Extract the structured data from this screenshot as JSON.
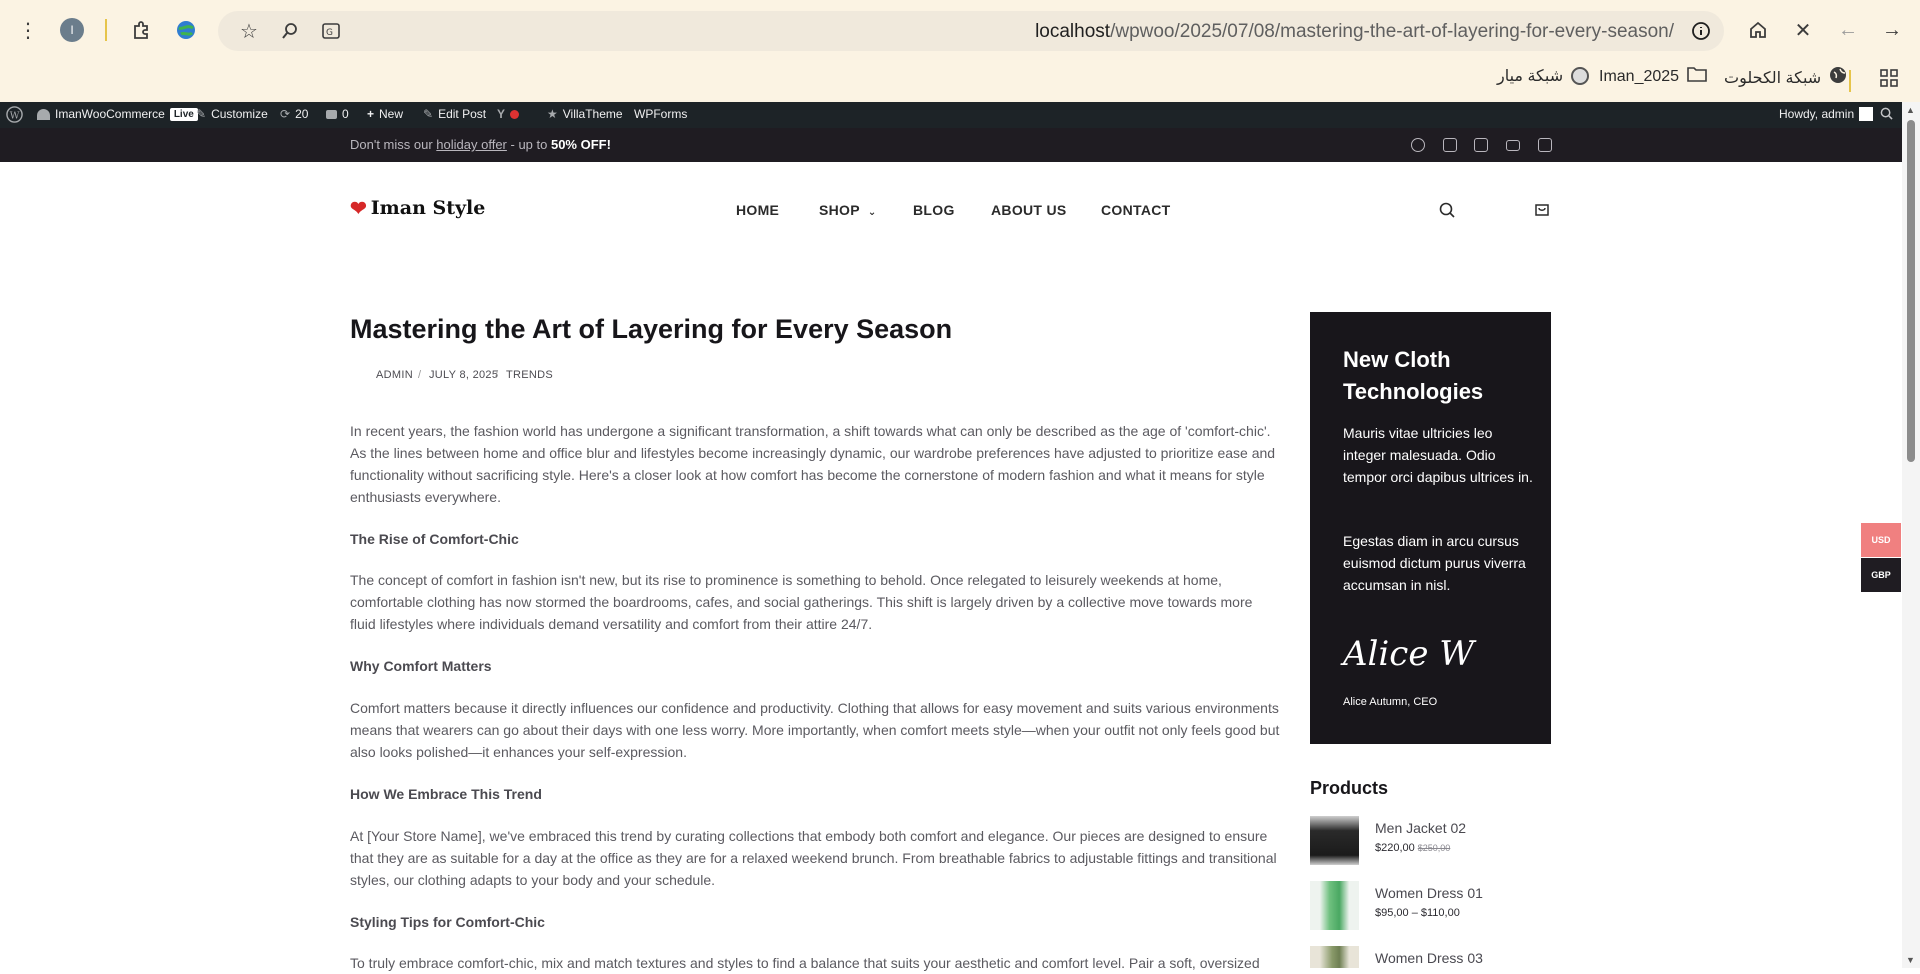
{
  "browser": {
    "url_host": "localhost",
    "url_path": "/wpwoo/2025/07/08/mastering-the-art-of-layering-for-every-season/",
    "profile_initial": "I",
    "bookmarks": [
      {
        "label": "شبكة الكحلوت",
        "icon": "globe-icon"
      },
      {
        "label": "Iman_2025",
        "icon": "folder-icon"
      },
      {
        "label": "شبكة ميار",
        "icon": "moon-icon"
      }
    ]
  },
  "admin_bar": {
    "site": "ImanWooCommerce",
    "live": "Live",
    "customize": "Customize",
    "updates": "20",
    "comments": "0",
    "new": "New",
    "edit_post": "Edit Post",
    "villatheme": "VillaTheme",
    "wpforms": "WPForms",
    "howdy": "Howdy, admin"
  },
  "promo": {
    "before": "Don't miss our ",
    "link": "holiday offer",
    "middle": " - up to ",
    "bold": "50% OFF!"
  },
  "header": {
    "logo": "Iman Style",
    "nav": [
      "HOME",
      "SHOP",
      "BLOG",
      "ABOUT US",
      "CONTACT"
    ]
  },
  "article": {
    "title": "Mastering the Art of Layering for Every Season",
    "author": "ADMIN",
    "date": "JULY 8, 2025",
    "category": "TRENDS",
    "p1": "In recent years, the fashion world has undergone a significant transformation, a shift towards what can only be described as the age of 'comfort-chic'. As the lines between home and office blur and lifestyles become increasingly dynamic, our wardrobe preferences have adjusted to prioritize ease and functionality without sacrificing style. Here's a closer look at how comfort has become the cornerstone of modern fashion and what it means for style enthusiasts everywhere.",
    "h1": "The Rise of Comfort-Chic",
    "p2": "The concept of comfort in fashion isn't new, but its rise to prominence is something to behold. Once relegated to leisurely weekends at home, comfortable clothing has now stormed the boardrooms, cafes, and social gatherings. This shift is largely driven by a collective move towards more fluid lifestyles where individuals demand versatility and comfort from their attire 24/7.",
    "h2": "Why Comfort Matters",
    "p3": "Comfort matters because it directly influences our confidence and productivity. Clothing that allows for easy movement and suits various environments means that wearers can go about their days with one less worry. More importantly, when comfort meets style—when your outfit not only feels good but also looks polished—it enhances your self-expression.",
    "h3": "How We Embrace This Trend",
    "p4": "At [Your Store Name], we've embraced this trend by curating collections that embody both comfort and elegance. Our pieces are designed to ensure that they are as suitable for a day at the office as they are for a relaxed weekend brunch. From breathable fabrics to adjustable fittings and transitional styles, our clothing adapts to your body and your schedule.",
    "h4": "Styling Tips for Comfort-Chic",
    "p5": "To truly embrace comfort-chic, mix and match textures and styles to find a balance that suits your aesthetic and comfort level. Pair a soft, oversized"
  },
  "sidebar": {
    "promo_title": "New Cloth Technologies",
    "promo_p1": "Mauris vitae ultricies leo integer malesuada. Odio tempor orci dapibus ultrices in.",
    "promo_p2": "Egestas diam in arcu cursus euismod dictum purus viverra accumsan in nisl.",
    "signature": "Alice W",
    "signer": "Alice Autumn, CEO",
    "products_title": "Products",
    "products": [
      {
        "name": "Men Jacket 02",
        "price": "$220,00",
        "old": "$250,00"
      },
      {
        "name": "Women Dress 01",
        "price": "$95,00 – $110,00",
        "old": ""
      },
      {
        "name": "Women Dress 03",
        "price": "",
        "old": ""
      }
    ]
  },
  "currency": [
    "USD",
    "GBP"
  ],
  "colors": {
    "usd": "#f08080",
    "gbp": "#1f1c22",
    "dark": "#18161b"
  }
}
